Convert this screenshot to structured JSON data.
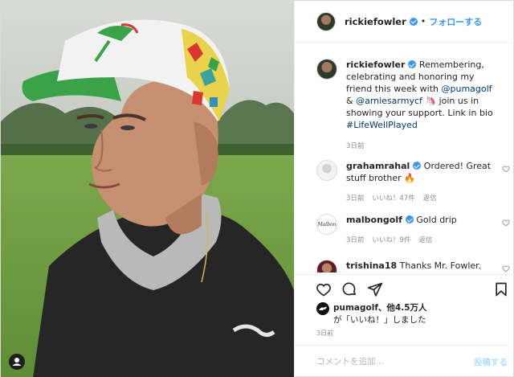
{
  "header": {
    "username": "rickiefowler",
    "separator": "•",
    "follow_label": "フォローする"
  },
  "caption": {
    "username": "rickiefowler",
    "text_1": " Remembering, celebrating and honoring my friend this week with ",
    "mention_1": "@pumagolf",
    "text_2": " & ",
    "mention_2": "@arniesarmycf",
    "text_3": " 🦄 join us in showing your support. Link in bio ",
    "hashtag": "#LifeWellPlayed",
    "date": "3日前"
  },
  "comments": [
    {
      "username": "grahamrahal",
      "text": " Ordered! Great stuff brother 🔥",
      "date": "3日前",
      "likes": "いいね！47件",
      "reply": "返信"
    },
    {
      "username": "malbongolf",
      "text": " Gold drip",
      "date": "3日前",
      "likes": "いいね！9件",
      "reply": "返信",
      "avatar_text": "Malbon"
    },
    {
      "username": "trishina18",
      "text": " Thanks Mr. Fowler."
    }
  ],
  "likes": {
    "account": "pumagolf",
    "others": "、他4.5万人",
    "suffix": "が「いいね！」しました"
  },
  "post_date": "3日前",
  "add_comment": {
    "placeholder": "コメントを追加...",
    "post_label": "投稿する"
  },
  "colors": {
    "accent": "#3897f0",
    "post_disabled": "#b2dffc",
    "muted": "#8e8e8e"
  },
  "icons": [
    "heart-icon",
    "comment-icon",
    "share-icon",
    "bookmark-icon",
    "user-tag-icon",
    "verified-badge"
  ]
}
